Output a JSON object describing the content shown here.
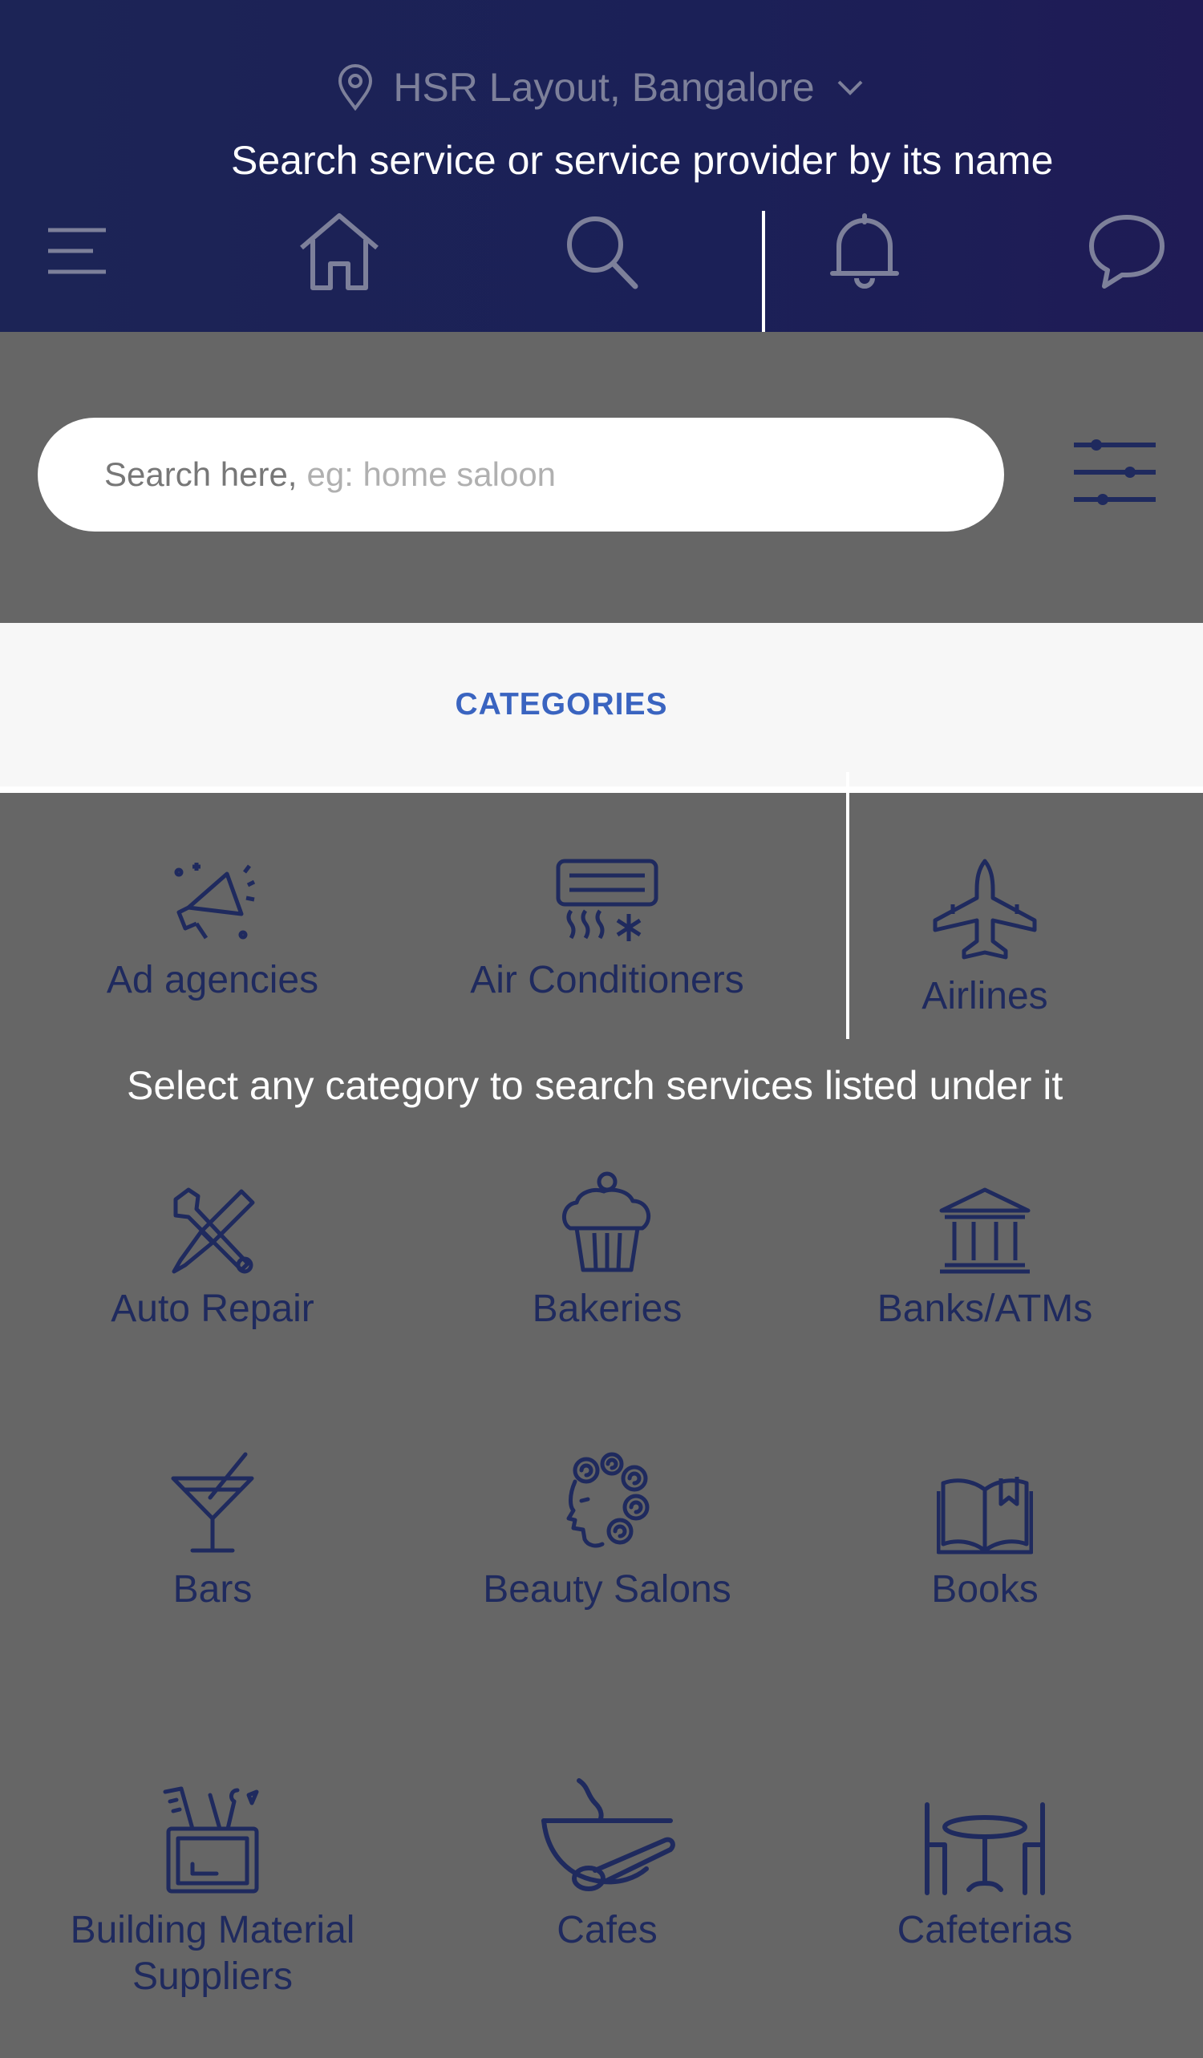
{
  "header": {
    "location": "HSR Layout, Bangalore",
    "hint": "Search service or service provider by its name",
    "nav": [
      {
        "name": "menu-icon"
      },
      {
        "name": "home-icon"
      },
      {
        "name": "search-icon"
      },
      {
        "name": "bell-icon"
      },
      {
        "name": "chat-icon"
      }
    ]
  },
  "search": {
    "placeholder_strong": "Search here,",
    "placeholder_light": "eg: home saloon"
  },
  "tabs": {
    "active": "CATEGORIES"
  },
  "categories_hint": "Select any category to search services listed under it",
  "categories": [
    {
      "label": "Ad agencies",
      "icon": "megaphone-icon"
    },
    {
      "label": "Air Conditioners",
      "icon": "air-conditioner-icon"
    },
    {
      "label": "Airlines",
      "icon": "airplane-icon"
    },
    {
      "label": "Auto Repair",
      "icon": "wrench-screwdriver-icon"
    },
    {
      "label": "Bakeries",
      "icon": "cupcake-icon"
    },
    {
      "label": "Banks/ATMs",
      "icon": "bank-icon"
    },
    {
      "label": "Bars",
      "icon": "cocktail-icon"
    },
    {
      "label": "Beauty Salons",
      "icon": "woman-hair-icon"
    },
    {
      "label": "Books",
      "icon": "open-book-icon"
    },
    {
      "label": "Building Material\nSuppliers",
      "icon": "toolbox-icon"
    },
    {
      "label": "Cafes",
      "icon": "coffee-bowl-icon"
    },
    {
      "label": "Cafeterias",
      "icon": "table-chairs-icon"
    }
  ],
  "colors": {
    "header": "#1c2456",
    "overlay": "#666666",
    "icon_line": "#1f2a5e",
    "tab_text": "#3a64c0"
  }
}
